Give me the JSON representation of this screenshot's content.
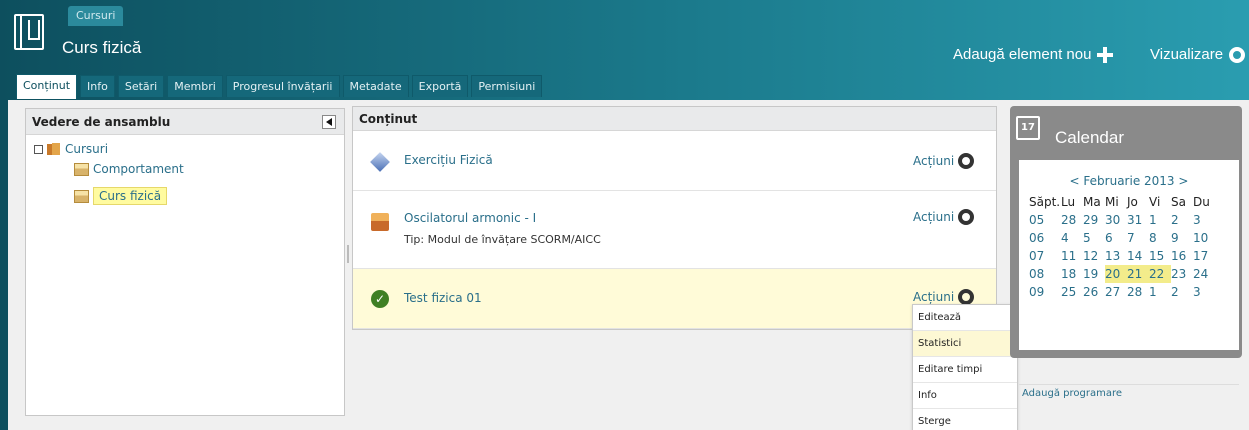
{
  "header": {
    "breadcrumb": "Cursuri",
    "title": "Curs fizică",
    "add_label": "Adaugă element nou",
    "view_label": "Vizualizare"
  },
  "tabs": [
    {
      "label": "Conținut",
      "active": true
    },
    {
      "label": "Info"
    },
    {
      "label": "Setări"
    },
    {
      "label": "Membri"
    },
    {
      "label": "Progresul învățarii"
    },
    {
      "label": "Metadate"
    },
    {
      "label": "Exportă"
    },
    {
      "label": "Permisiuni"
    }
  ],
  "overview": {
    "title": "Vedere de ansamblu",
    "root": "Cursuri",
    "children": [
      "Comportament",
      "Curs fizică"
    ]
  },
  "content": {
    "title": "Conținut",
    "actions_label": "Acțiuni",
    "items": [
      {
        "title": "Exercițiu Fizică",
        "icon": "exercise-icon"
      },
      {
        "title": "Oscilatorul armonic - I",
        "subtitle": "Tip: Modul de învățare SCORM/AICC",
        "icon": "scorm-package-icon"
      },
      {
        "title": "Test fizica 01",
        "icon": "test-check-icon"
      }
    ]
  },
  "dropdown": [
    "Editează",
    "Statistici",
    "Editare timpi",
    "Info",
    "Sterge"
  ],
  "calendar": {
    "icon_day": "17",
    "title": "Calendar",
    "month_nav": "< Februarie 2013 >",
    "headers": [
      "Săpt.",
      "Lu",
      "Ma",
      "Mi",
      "Jo",
      "Vi",
      "Sa",
      "Du"
    ],
    "weeks": [
      [
        "05",
        "28",
        "29",
        "30",
        "31",
        "1",
        "2",
        "3"
      ],
      [
        "06",
        "4",
        "5",
        "6",
        "7",
        "8",
        "9",
        "10"
      ],
      [
        "07",
        "11",
        "12",
        "13",
        "14",
        "15",
        "16",
        "17"
      ],
      [
        "08",
        "18",
        "19",
        "20",
        "21",
        "22",
        "23",
        "24"
      ],
      [
        "09",
        "25",
        "26",
        "27",
        "28",
        "1",
        "2",
        "3"
      ]
    ],
    "highlighted": [
      "20",
      "21",
      "22"
    ],
    "add_link": "Adaugă programare"
  },
  "colors": {
    "header": "#0d4f5e",
    "highlight": "#fffba0",
    "link": "#2a6f8a"
  }
}
